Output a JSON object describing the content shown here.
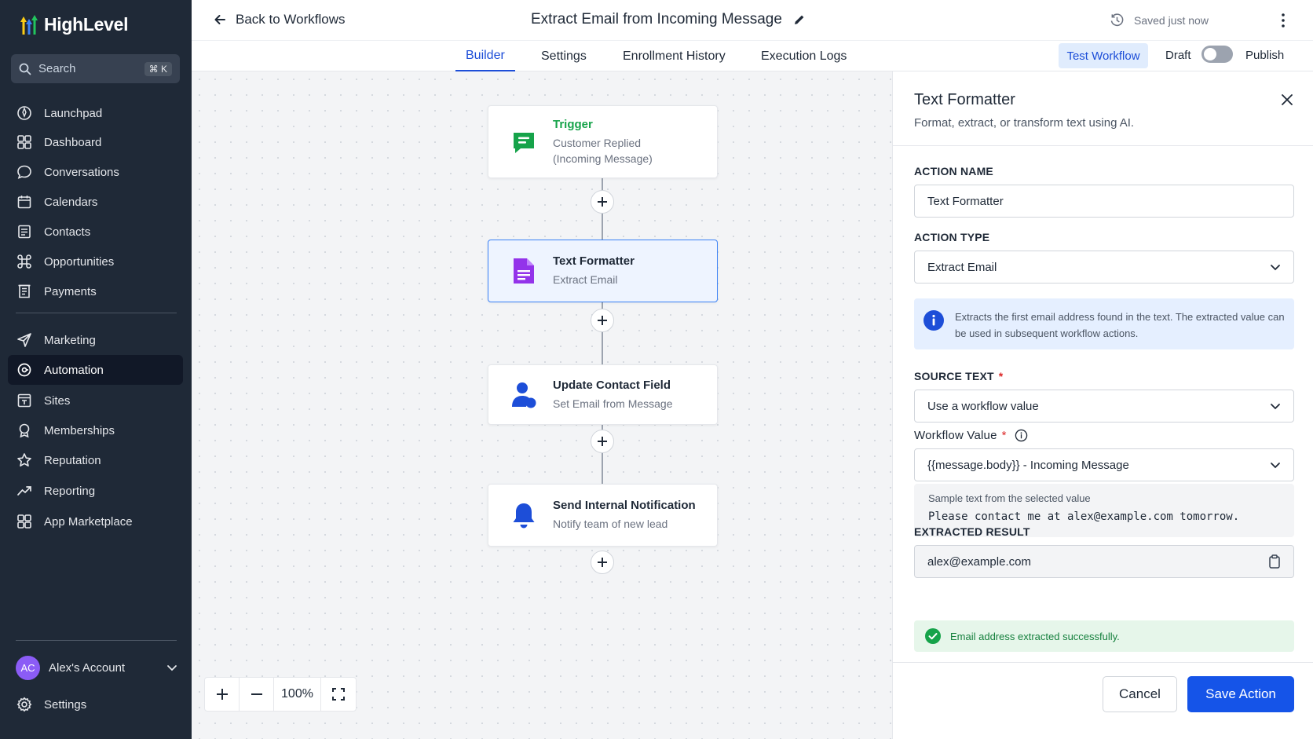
{
  "brand": {
    "name": "HighLevel"
  },
  "sidebar": {
    "search_placeholder": "Search",
    "search_shortcut": "⌘ K",
    "items": [
      {
        "label": "Launchpad",
        "icon": "launchpad-icon"
      },
      {
        "label": "Dashboard",
        "icon": "dashboard-icon"
      },
      {
        "label": "Conversations",
        "icon": "chat-bubble-icon"
      },
      {
        "label": "Calendars",
        "icon": "calendar-icon"
      },
      {
        "label": "Contacts",
        "icon": "contact-card-icon"
      },
      {
        "label": "Opportunities",
        "icon": "command-icon"
      },
      {
        "label": "Payments",
        "icon": "receipt-icon"
      },
      {
        "label": "Marketing",
        "icon": "send-icon"
      },
      {
        "label": "Automation",
        "icon": "automation-icon",
        "active": true
      },
      {
        "label": "Sites",
        "icon": "sites-icon"
      },
      {
        "label": "Memberships",
        "icon": "membership-icon"
      },
      {
        "label": "Reputation",
        "icon": "star-icon"
      },
      {
        "label": "Reporting",
        "icon": "trend-icon"
      },
      {
        "label": "App Marketplace",
        "icon": "grid-icon"
      }
    ],
    "account": {
      "initials": "AC",
      "name": "Alex's Account"
    },
    "settings_label": "Settings"
  },
  "header": {
    "back_label": "Back to Workflows",
    "title": "Extract Email from Incoming Message",
    "saved_status": "Saved just now",
    "tabs": [
      "Builder",
      "Settings",
      "Enrollment History",
      "Execution Logs"
    ],
    "active_tab": "Builder",
    "test_label": "Test Workflow",
    "draft_label": "Draft",
    "publish_label": "Publish",
    "published": false
  },
  "canvas": {
    "nodes": [
      {
        "title": "Trigger",
        "subtitle_lines": [
          "Customer Replied",
          "(Incoming Message)"
        ],
        "icon": "message-trigger-icon",
        "color": "#16a34a"
      },
      {
        "title": "Text Formatter",
        "subtitle_lines": [
          "Extract Email"
        ],
        "icon": "document-icon",
        "color": "#9333ea",
        "selected": true
      },
      {
        "title": "Update Contact Field",
        "subtitle_lines": [
          "Set Email from Message"
        ],
        "icon": "user-edit-icon",
        "color": "#1d4ed8"
      },
      {
        "title": "Send Internal Notification",
        "subtitle_lines": [
          "Notify team of new lead"
        ],
        "icon": "bell-icon",
        "color": "#1d4ed8"
      }
    ],
    "zoom": "100%"
  },
  "panel": {
    "title": "Text Formatter",
    "subtitle": "Format, extract, or transform text using AI.",
    "action_name_label": "ACTION NAME",
    "action_name_value": "Text Formatter",
    "action_type_label": "ACTION TYPE",
    "action_type_value": "Extract Email",
    "info_text": "Extracts the first email address found in the text. The extracted value can be used in subsequent workflow actions.",
    "source_text_label": "SOURCE TEXT",
    "source_text_value": "Use a workflow value",
    "workflow_value_label": "Workflow Value",
    "workflow_value_value": "{{message.body}} - Incoming Message",
    "sample_label": "Sample text from the selected value",
    "sample_value": "Please contact me at alex@example.com tomorrow.",
    "extracted_label": "EXTRACTED RESULT",
    "extracted_value": "alex@example.com",
    "success_text": "Email address extracted successfully.",
    "cancel_label": "Cancel",
    "save_label": "Save Action"
  },
  "colors": {
    "accent": "#1554e8",
    "sidebar_bg": "#1f2937",
    "success": "#16a34a",
    "required": "#dc2626"
  }
}
